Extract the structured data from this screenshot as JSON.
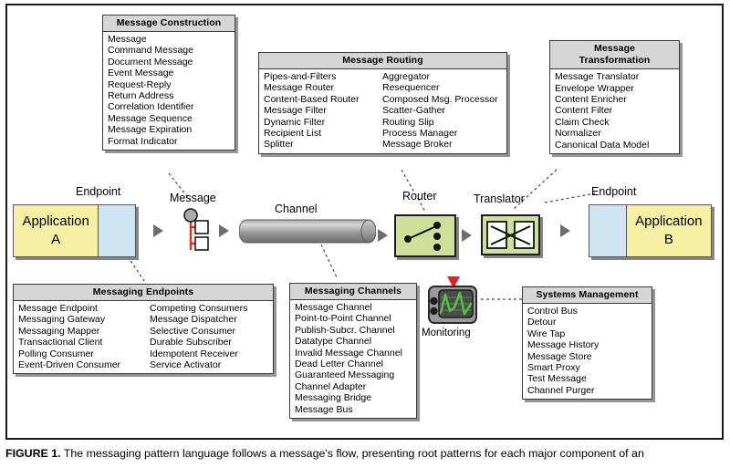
{
  "figure": {
    "caption_number": "FIGURE 1.",
    "caption_text": " The messaging pattern language follows a message's flow, presenting root patterns for each major component of an"
  },
  "colors": {
    "application_fill": "#f7efa4",
    "endpoint_fill": "#cfe6f2",
    "router_fill": "#cfe09b",
    "box_header_fill": "#d6d6d6",
    "message_accent": "#e03020",
    "monitoring_wave": "#55c043",
    "monitoring_marker": "#ee1c25",
    "arrow_fill": "#6d6d6d",
    "frame_border": "#1a1a1a"
  },
  "boxes": {
    "message_construction": {
      "title": "Message Construction",
      "columns": [
        [
          "Message",
          "Command Message",
          "Document Message",
          "Event Message",
          "Request-Reply",
          "Return Address",
          "Correlation Identifier",
          "Message Sequence",
          "Message Expiration",
          "Format Indicator"
        ]
      ]
    },
    "message_routing": {
      "title": "Message Routing",
      "columns": [
        [
          "Pipes-and-Filters",
          "Message Router",
          "Content-Based Router",
          "Message Filter",
          "Dynamic Filter",
          "Recipient List",
          "Splitter"
        ],
        [
          "Aggregator",
          "Resequencer",
          "Composed Msg. Processor",
          "Scatter-Gather",
          "Routing Slip",
          "Process Manager",
          "Message Broker"
        ]
      ]
    },
    "message_transformation": {
      "title_line1": "Message",
      "title_line2": "Transformation",
      "columns": [
        [
          "Message Translator",
          "Envelope Wrapper",
          "Content Enricher",
          "Content Filter",
          "Claim Check",
          "Normalizer",
          "Canonical Data Model"
        ]
      ]
    },
    "messaging_endpoints": {
      "title": "Messaging Endpoints",
      "columns": [
        [
          "Message Endpoint",
          "Messaging Gateway",
          "Messaging Mapper",
          "Transactional Client",
          "Polling Consumer",
          "Event-Driven Consumer"
        ],
        [
          "Competing Consumers",
          "Message Dispatcher",
          "Selective Consumer",
          "Durable Subscriber",
          "Idempotent Receiver",
          "Service Activator"
        ]
      ]
    },
    "messaging_channels": {
      "title": "Messaging Channels",
      "columns": [
        [
          "Message Channel",
          "Point-to-Point Channel",
          "Publish-Subcr. Channel",
          "Datatype Channel",
          "Invalid Message Channel",
          "Dead Letter Channel",
          "Guaranteed Messaging",
          "Channel Adapter",
          "Messaging Bridge",
          "Message Bus"
        ]
      ]
    },
    "systems_management": {
      "title": "Systems Management",
      "columns": [
        [
          "Control Bus",
          "Detour",
          "Wire Tap",
          "Message History",
          "Message Store",
          "Smart Proxy",
          "Test Message",
          "Channel Purger"
        ]
      ]
    }
  },
  "diagram": {
    "endpoint_left_label": "Endpoint",
    "endpoint_right_label": "Endpoint",
    "message_label": "Message",
    "channel_label": "Channel",
    "router_label": "Router",
    "translator_label": "Translator",
    "monitoring_label": "Monitoring",
    "application_a_line1": "Application",
    "application_a_line2": "A",
    "application_b_line1": "Application",
    "application_b_line2": "B"
  }
}
